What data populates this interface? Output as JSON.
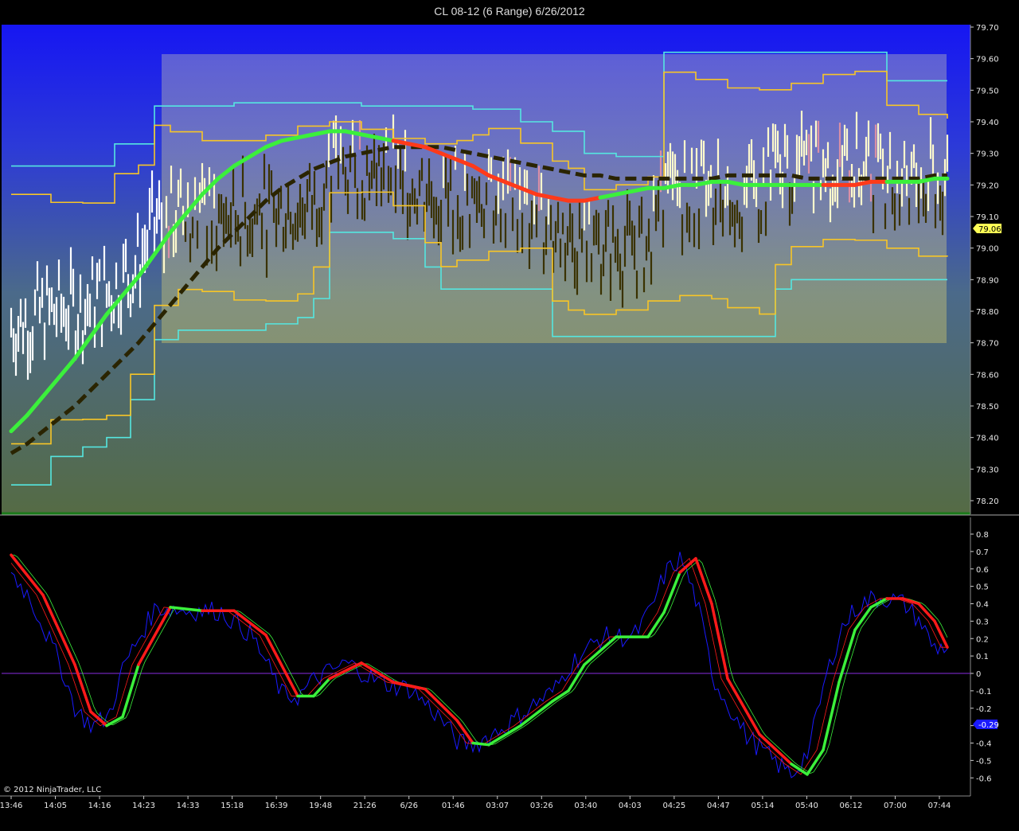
{
  "window": {
    "title": "CL 08-12 (6 Range)  6/26/2012"
  },
  "copyright": "© 2012 NinjaTrader, LLC",
  "colors": {
    "background": "#000000",
    "price_bg_top": "#1a1af0",
    "price_bg_bottom": "#556b45",
    "value_area_fill": "#c8c890",
    "bar_light": "#fffacd",
    "bar_dark": "#3a3200",
    "bar_pink": "#d98fa6",
    "bar_white": "#ffffff",
    "band_cyan": "#55e6e0",
    "band_yellow": "#f7c527",
    "ma_green": "#3bf03b",
    "ma_red": "#ff3a1a",
    "ma_dark": "#2a2400",
    "osc_blue": "#1a1aff",
    "osc_red": "#ff1a1a",
    "osc_green": "#3bf03b",
    "zero_line": "#8a2be2"
  },
  "chart_data": [
    {
      "type": "line",
      "panel": "price",
      "title": "CL 08-12 (6 Range)  6/26/2012",
      "ylim": [
        78.15,
        79.7
      ],
      "y_ticks": [
        "79.70",
        "79.60",
        "79.50",
        "79.40",
        "79.30",
        "79.20",
        "79.10",
        "79.00",
        "78.90",
        "78.80",
        "78.70",
        "78.60",
        "78.50",
        "78.40",
        "78.30",
        "78.20"
      ],
      "x_tick_labels": [
        "13:46",
        "14:05",
        "14:16",
        "14:23",
        "14:33",
        "15:18",
        "16:39",
        "19:48",
        "21:26",
        "6/26",
        "01:46",
        "03:07",
        "03:26",
        "03:40",
        "04:03",
        "04:25",
        "04:47",
        "05:14",
        "05:40",
        "06:12",
        "07:00",
        "07:44"
      ],
      "last_value": "79.06",
      "value_area": {
        "high": 79.61,
        "low": 78.7
      },
      "series": [
        {
          "role": "slow_ma",
          "style": "dashed",
          "x": [
            0,
            20,
            40,
            60,
            80,
            100,
            120,
            140,
            160,
            180,
            200,
            220,
            240,
            260,
            280,
            300,
            320,
            340,
            360,
            380,
            400,
            420,
            440,
            460,
            480,
            500,
            520,
            540,
            560,
            580,
            600,
            620,
            640,
            660,
            680,
            700,
            720,
            740,
            760,
            780,
            800,
            820,
            840,
            860,
            880,
            900,
            920,
            940,
            960,
            980,
            1000,
            1020,
            1040,
            1060,
            1080,
            1100,
            1120,
            1140,
            1160,
            1176
          ],
          "values": [
            78.35,
            78.38,
            78.42,
            78.46,
            78.5,
            78.55,
            78.6,
            78.65,
            78.7,
            78.76,
            78.82,
            78.88,
            78.94,
            79.0,
            79.05,
            79.1,
            79.15,
            79.19,
            79.22,
            79.25,
            79.27,
            79.29,
            79.3,
            79.31,
            79.32,
            79.32,
            79.32,
            79.32,
            79.31,
            79.3,
            79.29,
            79.28,
            79.27,
            79.26,
            79.25,
            79.24,
            79.23,
            79.23,
            79.22,
            79.22,
            79.22,
            79.22,
            79.22,
            79.22,
            79.22,
            79.23,
            79.23,
            79.23,
            79.23,
            79.23,
            79.22,
            79.22,
            79.22,
            79.22,
            79.22,
            79.22,
            79.22,
            79.22,
            79.23,
            79.23
          ]
        },
        {
          "role": "fast_ma",
          "style": "colored",
          "x": [
            0,
            20,
            40,
            60,
            80,
            100,
            120,
            140,
            160,
            180,
            200,
            220,
            240,
            260,
            280,
            300,
            320,
            340,
            360,
            380,
            400,
            420,
            440,
            460,
            480,
            500,
            520,
            540,
            560,
            580,
            600,
            620,
            640,
            660,
            680,
            700,
            720,
            740,
            760,
            780,
            800,
            820,
            840,
            860,
            880,
            900,
            920,
            940,
            960,
            980,
            1000,
            1020,
            1040,
            1060,
            1080,
            1100,
            1120,
            1140,
            1160,
            1176
          ],
          "values": [
            78.42,
            78.47,
            78.53,
            78.59,
            78.65,
            78.72,
            78.79,
            78.85,
            78.91,
            78.98,
            79.05,
            79.11,
            79.17,
            79.22,
            79.26,
            79.29,
            79.32,
            79.34,
            79.35,
            79.36,
            79.37,
            79.37,
            79.36,
            79.35,
            79.34,
            79.33,
            79.32,
            79.3,
            79.28,
            79.26,
            79.23,
            79.21,
            79.19,
            79.17,
            79.16,
            79.15,
            79.15,
            79.16,
            79.17,
            79.18,
            79.19,
            79.19,
            79.2,
            79.2,
            79.21,
            79.21,
            79.2,
            79.2,
            79.2,
            79.2,
            79.2,
            79.2,
            79.2,
            79.2,
            79.21,
            79.21,
            79.21,
            79.21,
            79.22,
            79.22
          ],
          "colors": [
            "green",
            "green",
            "green",
            "green",
            "green",
            "green",
            "green",
            "green",
            "green",
            "green",
            "green",
            "green",
            "green",
            "green",
            "green",
            "green",
            "green",
            "green",
            "green",
            "green",
            "green",
            "green",
            "green",
            "green",
            "green",
            "red",
            "red",
            "red",
            "red",
            "red",
            "red",
            "red",
            "red",
            "red",
            "red",
            "red",
            "red",
            "red",
            "green",
            "green",
            "green",
            "green",
            "green",
            "green",
            "green",
            "green",
            "green",
            "green",
            "green",
            "green",
            "green",
            "green",
            "red",
            "red",
            "red",
            "red",
            "green",
            "green",
            "green",
            "green"
          ]
        },
        {
          "role": "upper_band",
          "x": [
            0,
            50,
            90,
            130,
            160,
            180,
            200,
            240,
            280,
            320,
            360,
            400,
            440,
            480,
            520,
            560,
            580,
            600,
            640,
            680,
            700,
            720,
            760,
            800,
            820,
            860,
            900,
            940,
            980,
            1020,
            1060,
            1100,
            1140,
            1176
          ],
          "values": [
            79.26,
            79.26,
            79.26,
            79.33,
            79.33,
            79.45,
            79.45,
            79.45,
            79.46,
            79.46,
            79.46,
            79.46,
            79.45,
            79.45,
            79.45,
            79.45,
            79.44,
            79.44,
            79.4,
            79.37,
            79.37,
            79.3,
            79.29,
            79.29,
            79.62,
            79.62,
            79.62,
            79.62,
            79.62,
            79.62,
            79.62,
            79.53,
            79.53,
            79.53
          ]
        },
        {
          "role": "lower_band",
          "x": [
            0,
            50,
            90,
            120,
            150,
            180,
            210,
            240,
            280,
            320,
            360,
            380,
            400,
            440,
            480,
            520,
            540,
            560,
            600,
            640,
            680,
            700,
            720,
            760,
            800,
            840,
            880,
            900,
            940,
            960,
            980,
            1020,
            1060,
            1100,
            1140,
            1176
          ],
          "values": [
            78.25,
            78.34,
            78.37,
            78.4,
            78.52,
            78.71,
            78.74,
            78.74,
            78.74,
            78.76,
            78.78,
            78.84,
            79.05,
            79.05,
            79.03,
            78.94,
            78.87,
            78.87,
            78.87,
            78.87,
            78.72,
            78.72,
            78.72,
            78.72,
            78.72,
            78.72,
            78.72,
            78.72,
            78.72,
            78.87,
            78.9,
            78.9,
            78.9,
            78.9,
            78.9,
            78.9
          ]
        }
      ]
    },
    {
      "type": "line",
      "panel": "oscillator",
      "ylim": [
        -0.65,
        0.85
      ],
      "y_ticks": [
        "0.8",
        "0.7",
        "0.6",
        "0.5",
        "0.4",
        "0.3",
        "0.2",
        "0.1",
        "0",
        "-0.1",
        "-0.2",
        "-0.3",
        "-0.4",
        "-0.5",
        "-0.6"
      ],
      "last_value": "-0.29",
      "series": [
        {
          "role": "signal_slow",
          "x": [
            0,
            40,
            80,
            100,
            120,
            140,
            160,
            200,
            240,
            280,
            320,
            360,
            380,
            400,
            440,
            480,
            520,
            560,
            580,
            600,
            640,
            680,
            700,
            720,
            760,
            800,
            820,
            840,
            860,
            880,
            900,
            940,
            980,
            1000,
            1020,
            1040,
            1060,
            1080,
            1100,
            1120,
            1140,
            1160,
            1176
          ],
          "values": [
            0.68,
            0.45,
            0.05,
            -0.22,
            -0.3,
            -0.25,
            0.05,
            0.38,
            0.36,
            0.36,
            0.22,
            -0.13,
            -0.13,
            -0.03,
            0.06,
            -0.05,
            -0.09,
            -0.27,
            -0.4,
            -0.41,
            -0.3,
            -0.16,
            -0.1,
            0.05,
            0.21,
            0.21,
            0.35,
            0.58,
            0.66,
            0.4,
            -0.03,
            -0.35,
            -0.52,
            -0.58,
            -0.44,
            -0.05,
            0.25,
            0.38,
            0.43,
            0.43,
            0.4,
            0.3,
            0.15
          ],
          "colors": [
            "red",
            "red",
            "red",
            "red",
            "red",
            "green",
            "green",
            "red",
            "green",
            "red",
            "red",
            "red",
            "green",
            "green",
            "red",
            "red",
            "red",
            "red",
            "red",
            "green",
            "green",
            "green",
            "green",
            "green",
            "green",
            "green",
            "green",
            "green",
            "red",
            "red",
            "red",
            "red",
            "red",
            "green",
            "green",
            "green",
            "green",
            "green",
            "green",
            "red",
            "red",
            "red",
            "red"
          ]
        }
      ]
    }
  ]
}
